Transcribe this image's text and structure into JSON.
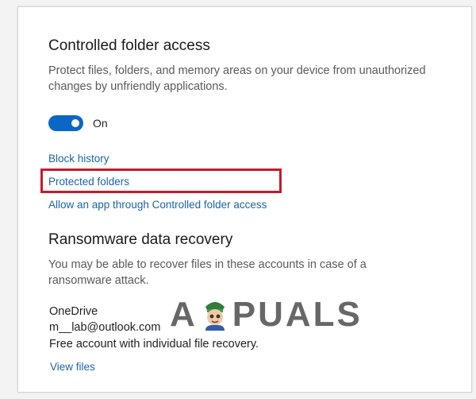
{
  "controlled_folder_access": {
    "title": "Controlled folder access",
    "description_line1": "Protect files, folders, and memory areas on your device from unauthorized",
    "description_line2": "changes by unfriendly applications.",
    "toggle": {
      "on": true,
      "state_label": "On"
    },
    "links": {
      "block_history": "Block history",
      "protected_folders": "Protected folders",
      "allow_app": "Allow an app through Controlled folder access"
    }
  },
  "ransomware_recovery": {
    "title": "Ransomware data recovery",
    "description_line1": "You may be able to recover files in these accounts in case of a",
    "description_line2": "ransomware attack.",
    "account": {
      "service": "OneDrive",
      "email": "m__lab@outlook.com",
      "plan": "Free account with individual file recovery."
    },
    "view_files_link": "View files"
  },
  "colors": {
    "accent": "#0b67c5",
    "link": "#1b64a8",
    "highlight": "#c8192b"
  },
  "watermark": {
    "text": "APPUALS"
  }
}
